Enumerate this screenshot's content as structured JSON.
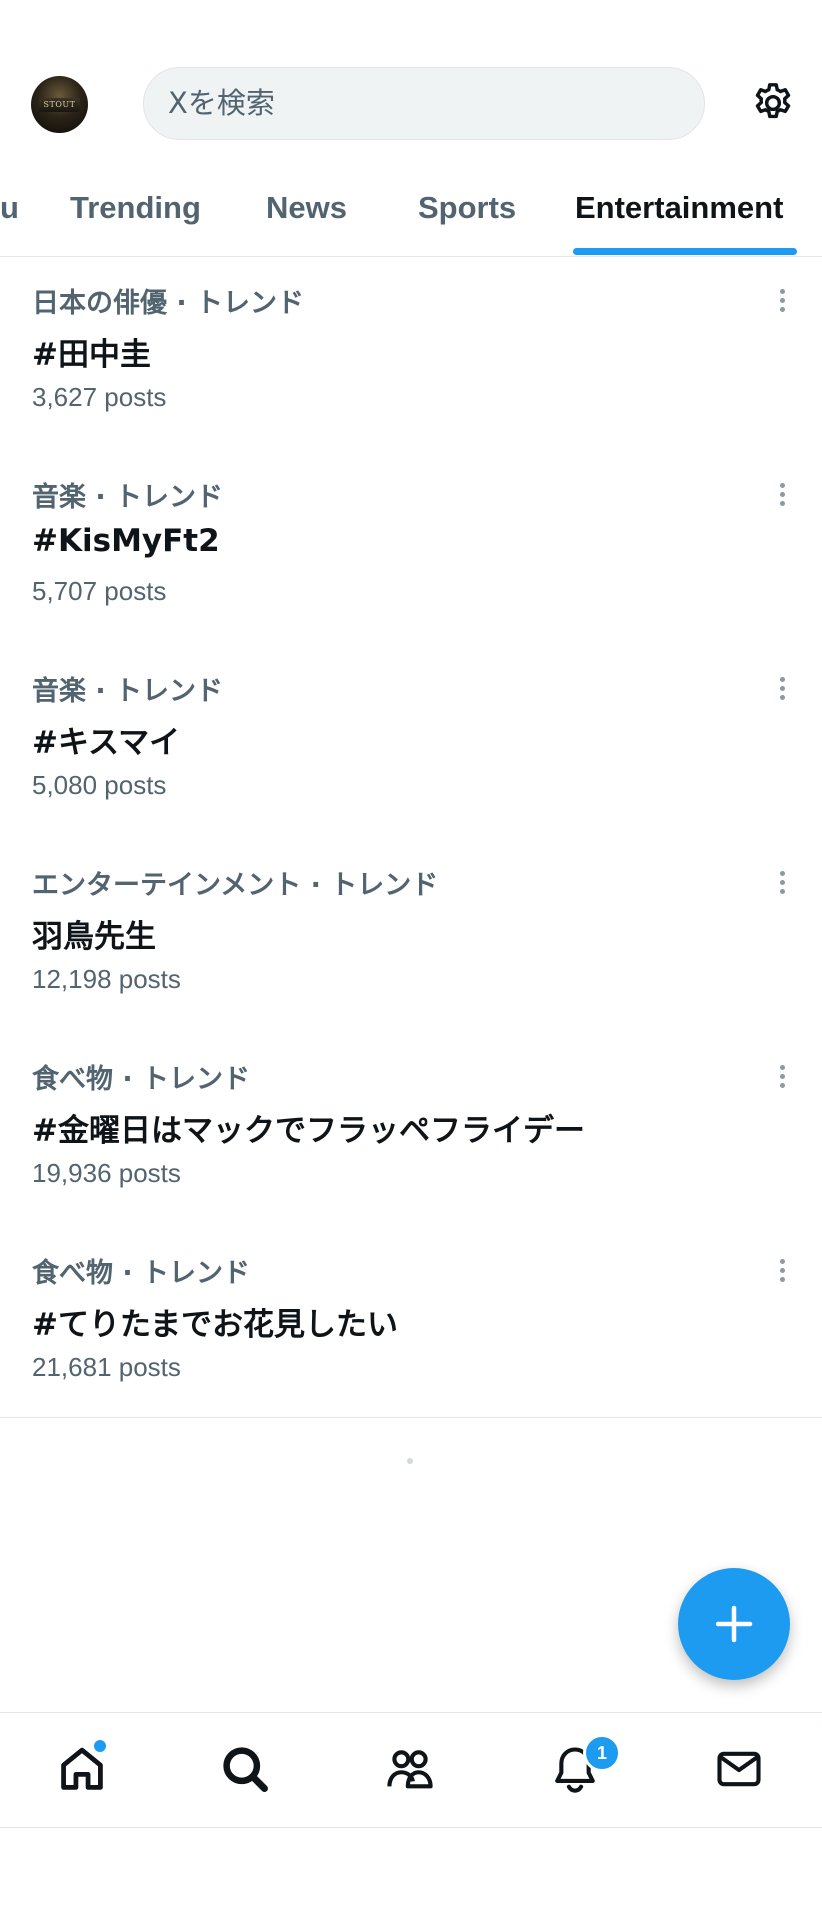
{
  "header": {
    "search_placeholder": "Xを検索"
  },
  "tabs": [
    {
      "label": "u"
    },
    {
      "label": "Trending"
    },
    {
      "label": "News"
    },
    {
      "label": "Sports"
    },
    {
      "label": "Entertainment",
      "active": true
    }
  ],
  "trends": [
    {
      "category": "日本の俳優 · トレンド",
      "name": "#田中圭",
      "posts": "3,627 posts"
    },
    {
      "category": "音楽 · トレンド",
      "name": "#KisMyFt2",
      "posts": "5,707 posts"
    },
    {
      "category": "音楽 · トレンド",
      "name": "#キスマイ",
      "posts": "5,080 posts"
    },
    {
      "category": "エンターテインメント · トレンド",
      "name": "羽鳥先生",
      "posts": "12,198 posts"
    },
    {
      "category": "食べ物 · トレンド",
      "name": "#金曜日はマックでフラッペフライデー",
      "posts": "19,936 posts"
    },
    {
      "category": "食べ物 · トレンド",
      "name": "#てりたまでお花見したい",
      "posts": "21,681 posts"
    }
  ],
  "bottom_nav": {
    "notifications_badge": "1"
  },
  "colors": {
    "accent": "#1d9bf0",
    "text_primary": "#0f1419",
    "text_secondary": "#536471"
  }
}
